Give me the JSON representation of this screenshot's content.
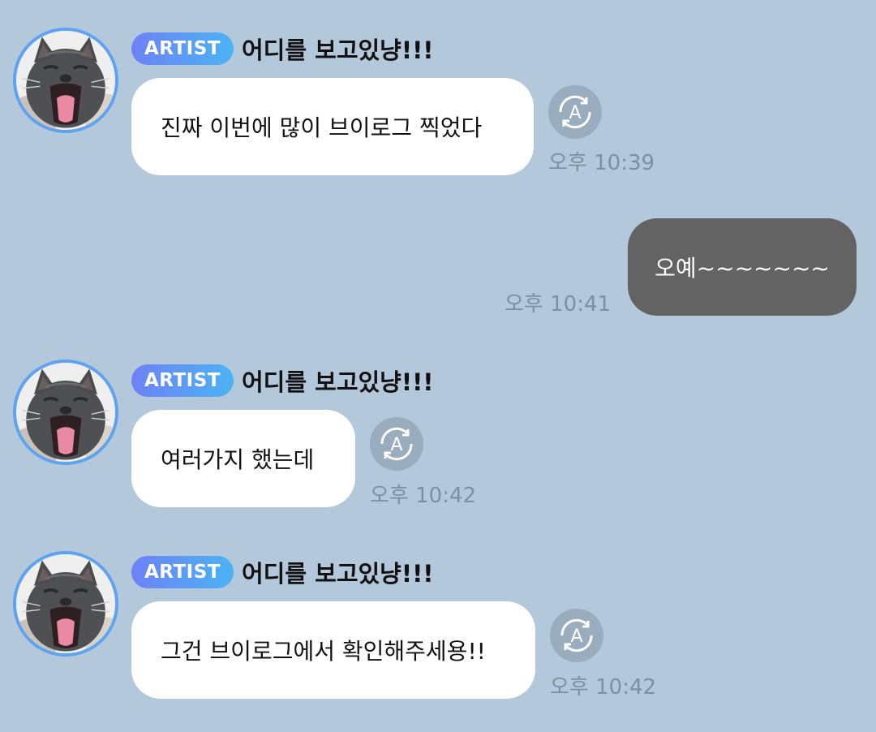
{
  "messages": [
    {
      "badge": "ARTIST",
      "sender": "어디를 보고있냥!!!",
      "text": "진짜 이번에 많이 브이로그 찍었다",
      "time": "오후 10:39"
    },
    {
      "text": "오예~~~~~~~",
      "time": "오후 10:41"
    },
    {
      "badge": "ARTIST",
      "sender": "어디를 보고있냥!!!",
      "text": "여러가지 했는데",
      "time": "오후 10:42"
    },
    {
      "badge": "ARTIST",
      "sender": "어디를 보고있냥!!!",
      "text": "그건 브이로그에서 확인해주세용!!",
      "time": "오후 10:42"
    }
  ],
  "colors": {
    "background": "#b3c8da",
    "incoming_bubble": "#ffffff",
    "outgoing_bubble": "#636363",
    "badge_gradient_start": "#6d82f6",
    "badge_gradient_end": "#4bb3f3",
    "avatar_ring": "#5ea2f0",
    "translate_button": "#9aadbf"
  },
  "icons": {
    "translate": "translate-icon",
    "avatar": "cat-avatar"
  }
}
